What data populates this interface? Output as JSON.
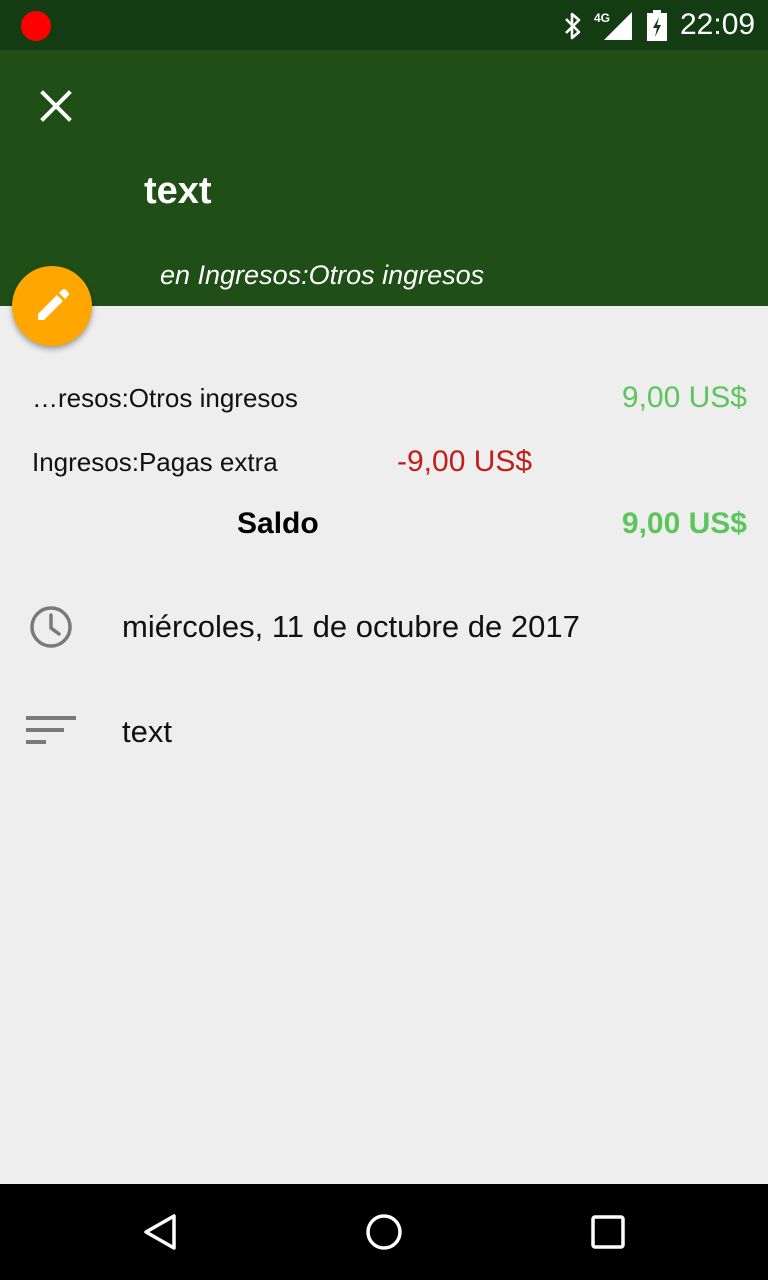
{
  "status_bar": {
    "time": "22:09",
    "network": "4G",
    "icons": [
      "record-icon",
      "bluetooth-icon",
      "signal-icon",
      "battery-icon"
    ]
  },
  "header": {
    "close_icon": "close-icon",
    "title": "text",
    "subtitle": "en Ingresos:Otros ingresos",
    "edit_icon": "pencil-icon"
  },
  "splits": [
    {
      "account": "…resos:Otros ingresos",
      "amount": "9,00 US$"
    },
    {
      "account": "Ingresos:Pagas extra",
      "amount": "-9,00 US$"
    }
  ],
  "balance": {
    "label": "Saldo",
    "amount": "9,00 US$"
  },
  "details": {
    "date": "miércoles, 11 de octubre de 2017",
    "notes": "text"
  },
  "nav_bar": {
    "icons": [
      "back-icon",
      "home-icon",
      "recents-icon"
    ]
  },
  "colors": {
    "status_bar": "#133c12",
    "app_bar": "#1f4f17",
    "fab": "#ffa600",
    "positive": "#5cc55c",
    "negative": "#c0201b",
    "background": "#eeeeee"
  }
}
